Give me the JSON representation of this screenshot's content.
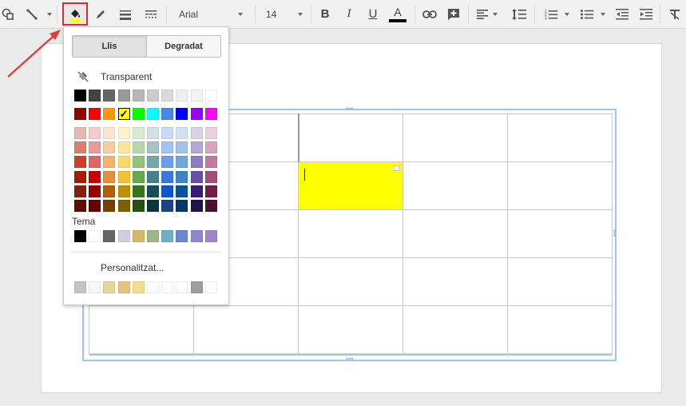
{
  "toolbar": {
    "font_name": "Arial",
    "font_size": "14",
    "text_color_letter": "A"
  },
  "color_menu": {
    "tabs": [
      {
        "label": "Llis",
        "active": true
      },
      {
        "label": "Degradat",
        "active": false
      }
    ],
    "transparent_label": "Transparent",
    "theme_label": "Tema",
    "custom_label": "Personalitzat...",
    "grays": [
      "#000000",
      "#434343",
      "#666666",
      "#999999",
      "#b7b7b7",
      "#cccccc",
      "#d9d9d9",
      "#efefef",
      "#f3f3f3",
      "#ffffff"
    ],
    "brights": [
      "#980000",
      "#ff0000",
      "#ff9900",
      "#ffff00",
      "#00ff00",
      "#00ffff",
      "#4a86e8",
      "#0000ff",
      "#9900ff",
      "#ff00ff"
    ],
    "selected_bright_index": 3,
    "shades": [
      [
        "#e6b8af",
        "#f4cccc",
        "#fce5cd",
        "#fff2cc",
        "#d9ead3",
        "#d0e0e3",
        "#c9daf8",
        "#cfe2f3",
        "#d9d2e9",
        "#ead1dc"
      ],
      [
        "#dd7e6b",
        "#ea9999",
        "#f9cb9c",
        "#ffe599",
        "#b6d7a8",
        "#a2c4c9",
        "#a4c2f4",
        "#9fc5e8",
        "#b4a7d6",
        "#d5a6bd"
      ],
      [
        "#cc4125",
        "#e06666",
        "#f6b26b",
        "#ffd966",
        "#93c47d",
        "#76a5af",
        "#6d9eeb",
        "#6fa8dc",
        "#8e7cc3",
        "#c27ba0"
      ],
      [
        "#a61c00",
        "#cc0000",
        "#e69138",
        "#f1c232",
        "#6aa84f",
        "#45818e",
        "#3c78d8",
        "#3d85c6",
        "#674ea7",
        "#a64d79"
      ],
      [
        "#85200c",
        "#990000",
        "#b45f06",
        "#bf9000",
        "#38761d",
        "#134f5c",
        "#1155cc",
        "#0b5394",
        "#351c75",
        "#741b47"
      ],
      [
        "#5b0f00",
        "#660000",
        "#783f04",
        "#7f6000",
        "#274e13",
        "#0c343d",
        "#1c4587",
        "#073763",
        "#20124d",
        "#4c1130"
      ]
    ],
    "theme_colors": [
      "#000000",
      "#ffffff",
      "#666666",
      "#cfcfe0",
      "#d4b96a",
      "#9db58a",
      "#6fb0c4",
      "#6b87d0",
      "#8e86cf",
      "#a085c9"
    ],
    "custom_colors": [
      "#c4c4c4",
      "#f7f7f7",
      "#ecd39b",
      "#e2c57f",
      "#f3dc93",
      "#ffffff",
      "#ffffff",
      "#ffffff",
      "#9e9e9e",
      "#ffffff"
    ]
  },
  "table": {
    "highlight_color": "#ffff00"
  }
}
